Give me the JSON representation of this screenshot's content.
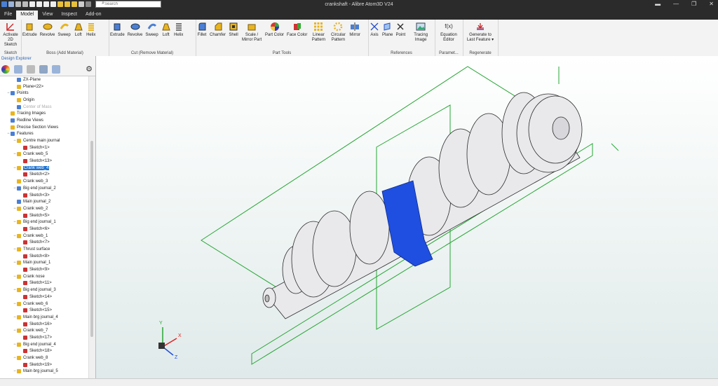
{
  "window": {
    "title": "crankshaft - Alibre Atom3D V24",
    "search_placeholder": "Search"
  },
  "tabs": [
    "File",
    "Model",
    "View",
    "Inspect",
    "Add-on"
  ],
  "ribbon": {
    "groups": [
      {
        "label": "Sketch",
        "buttons": [
          "Activate 2D Sketch"
        ]
      },
      {
        "label": "Boss (Add Material)",
        "buttons": [
          "Extrude",
          "Revolve",
          "Sweep",
          "Loft",
          "Helix"
        ]
      },
      {
        "label": "Cut (Remove Material)",
        "buttons": [
          "Extrude",
          "Revolve",
          "Sweep",
          "Loft",
          "Helix"
        ]
      },
      {
        "label": "Part Tools",
        "buttons": [
          "Fillet",
          "Chamfer",
          "Shell",
          "Scale / Mirror Part",
          "Part Color",
          "Face Color",
          "Linear Pattern",
          "Circular Pattern",
          "Mirror"
        ]
      },
      {
        "label": "References",
        "buttons": [
          "Axis",
          "Plane",
          "Point",
          "Tracing Image"
        ]
      },
      {
        "label": "Paramet...",
        "buttons": [
          "Equation Editor"
        ]
      },
      {
        "label": "Regenerate",
        "buttons": [
          "Generate to Last Feature ▾"
        ]
      }
    ]
  },
  "explorer": {
    "title": "Design Explorer",
    "tree": [
      {
        "label": "ZX-Plane",
        "d": 2,
        "t": ""
      },
      {
        "label": "Plane<22>",
        "d": 2,
        "t": ""
      },
      {
        "label": "Points",
        "d": 1,
        "t": "−"
      },
      {
        "label": "Origin",
        "d": 2,
        "t": ""
      },
      {
        "label": "Center of Mass",
        "d": 2,
        "t": "",
        "dim": true
      },
      {
        "label": "Tracing Images",
        "d": 1,
        "t": ""
      },
      {
        "label": "Redline Views",
        "d": 1,
        "t": ""
      },
      {
        "label": "Precise Section Views",
        "d": 1,
        "t": ""
      },
      {
        "label": "Features",
        "d": 1,
        "t": "−"
      },
      {
        "label": "Centre main journal",
        "d": 2,
        "t": "−"
      },
      {
        "label": "Sketch<1>",
        "d": 3,
        "t": ""
      },
      {
        "label": "Crank web_5",
        "d": 2,
        "t": "−"
      },
      {
        "label": "Sketch<13>",
        "d": 3,
        "t": ""
      },
      {
        "label": "Crank web_4",
        "d": 2,
        "t": "−",
        "sel": true
      },
      {
        "label": "Sketch<2>",
        "d": 3,
        "t": ""
      },
      {
        "label": "Crank web_3",
        "d": 2,
        "t": ""
      },
      {
        "label": "Big end journal_2",
        "d": 2,
        "t": "−"
      },
      {
        "label": "Sketch<3>",
        "d": 3,
        "t": ""
      },
      {
        "label": "Main journal_2",
        "d": 2,
        "t": ""
      },
      {
        "label": "Crank web_2",
        "d": 2,
        "t": "−"
      },
      {
        "label": "Sketch<5>",
        "d": 3,
        "t": ""
      },
      {
        "label": "Big end journal_1",
        "d": 2,
        "t": "−"
      },
      {
        "label": "Sketch<6>",
        "d": 3,
        "t": ""
      },
      {
        "label": "Crank web_1",
        "d": 2,
        "t": "−"
      },
      {
        "label": "Sketch<7>",
        "d": 3,
        "t": ""
      },
      {
        "label": "Thrust surface",
        "d": 2,
        "t": "−"
      },
      {
        "label": "Sketch<8>",
        "d": 3,
        "t": ""
      },
      {
        "label": "Main journal_1",
        "d": 2,
        "t": "−"
      },
      {
        "label": "Sketch<9>",
        "d": 3,
        "t": ""
      },
      {
        "label": "Crank nose",
        "d": 2,
        "t": "−"
      },
      {
        "label": "Sketch<11>",
        "d": 3,
        "t": ""
      },
      {
        "label": "Big end journal_3",
        "d": 2,
        "t": "−"
      },
      {
        "label": "Sketch<14>",
        "d": 3,
        "t": ""
      },
      {
        "label": "Crank web_6",
        "d": 2,
        "t": "−"
      },
      {
        "label": "Sketch<15>",
        "d": 3,
        "t": ""
      },
      {
        "label": "Main brg journal_4",
        "d": 2,
        "t": "−"
      },
      {
        "label": "Sketch<16>",
        "d": 3,
        "t": ""
      },
      {
        "label": "Crank web_7",
        "d": 2,
        "t": "−"
      },
      {
        "label": "Sketch<17>",
        "d": 3,
        "t": ""
      },
      {
        "label": "Big end journal_4",
        "d": 2,
        "t": "−"
      },
      {
        "label": "Sketch<18>",
        "d": 3,
        "t": ""
      },
      {
        "label": "Crank web_8",
        "d": 2,
        "t": "−"
      },
      {
        "label": "Sketch<19>",
        "d": 3,
        "t": ""
      },
      {
        "label": "Main brg journal_5",
        "d": 2,
        "t": "−"
      }
    ]
  },
  "triad": {
    "x": "X",
    "y": "Y",
    "z": "Z"
  },
  "colors": {
    "selection": "#1e72d0",
    "highlight_feature": "#1f4fe0",
    "plane_lines": "#27a635"
  }
}
